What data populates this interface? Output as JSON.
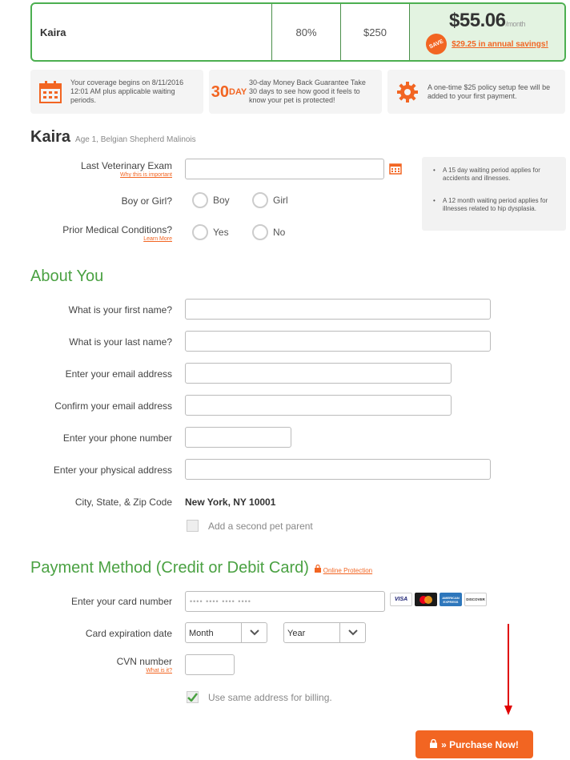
{
  "plan": {
    "pet_name": "Kaira",
    "reimbursement": "80%",
    "deductible": "$250",
    "price": "$55.06",
    "per": "/month",
    "save_badge": "SAVE",
    "savings": "$29.25 in annual savings!"
  },
  "info_boxes": {
    "coverage": "Your coverage begins on 8/11/2016 12:01 AM plus applicable waiting periods.",
    "money_back_number": "30",
    "money_back_unit": "DAY",
    "money_back": "30-day Money Back Guarantee Take 30 days to see how good it feels to know your pet is protected!",
    "setup_fee": "A one-time $25 policy setup fee will be added to your first payment."
  },
  "pet": {
    "name": "Kaira",
    "details": "Age 1, Belgian Shepherd Malinois",
    "vet_exam_label": "Last Veterinary Exam",
    "vet_exam_link": "Why this is important",
    "gender_label": "Boy or Girl?",
    "gender_options": [
      "Boy",
      "Girl"
    ],
    "medical_label": "Prior Medical Conditions?",
    "medical_link": "Learn More",
    "medical_options": [
      "Yes",
      "No"
    ],
    "notes": [
      "A 15 day waiting period applies for accidents and illnesses.",
      "A 12 month waiting period applies for illnesses related to hip dysplasia."
    ]
  },
  "about": {
    "title": "About You",
    "first_name_label": "What is your first name?",
    "last_name_label": "What is your last name?",
    "email_label": "Enter your email address",
    "confirm_email_label": "Confirm your email address",
    "phone_label": "Enter your phone number",
    "address_label": "Enter your physical address",
    "city_label": "City, State, & Zip Code",
    "city_value": "New York, NY 10001",
    "second_parent_label": "Add a second pet parent"
  },
  "payment": {
    "title": "Payment Method (Credit or Debit Card)",
    "protection_link": "Online Protection",
    "card_label": "Enter your card number",
    "card_placeholder": "•••• •••• •••• ••••",
    "card_brands": [
      "VISA",
      "MasterCard",
      "AMERICAN EXPRESS",
      "DISCOVER"
    ],
    "expiry_label": "Card expiration date",
    "month": "Month",
    "year": "Year",
    "cvn_label": "CVN number",
    "cvn_link": "What is it?",
    "same_address_label": "Use same address for billing.",
    "purchase": "» Purchase Now!"
  },
  "colors": {
    "accent": "#f26522",
    "green": "#4aa142",
    "annotation_arrow": "#e00000"
  }
}
